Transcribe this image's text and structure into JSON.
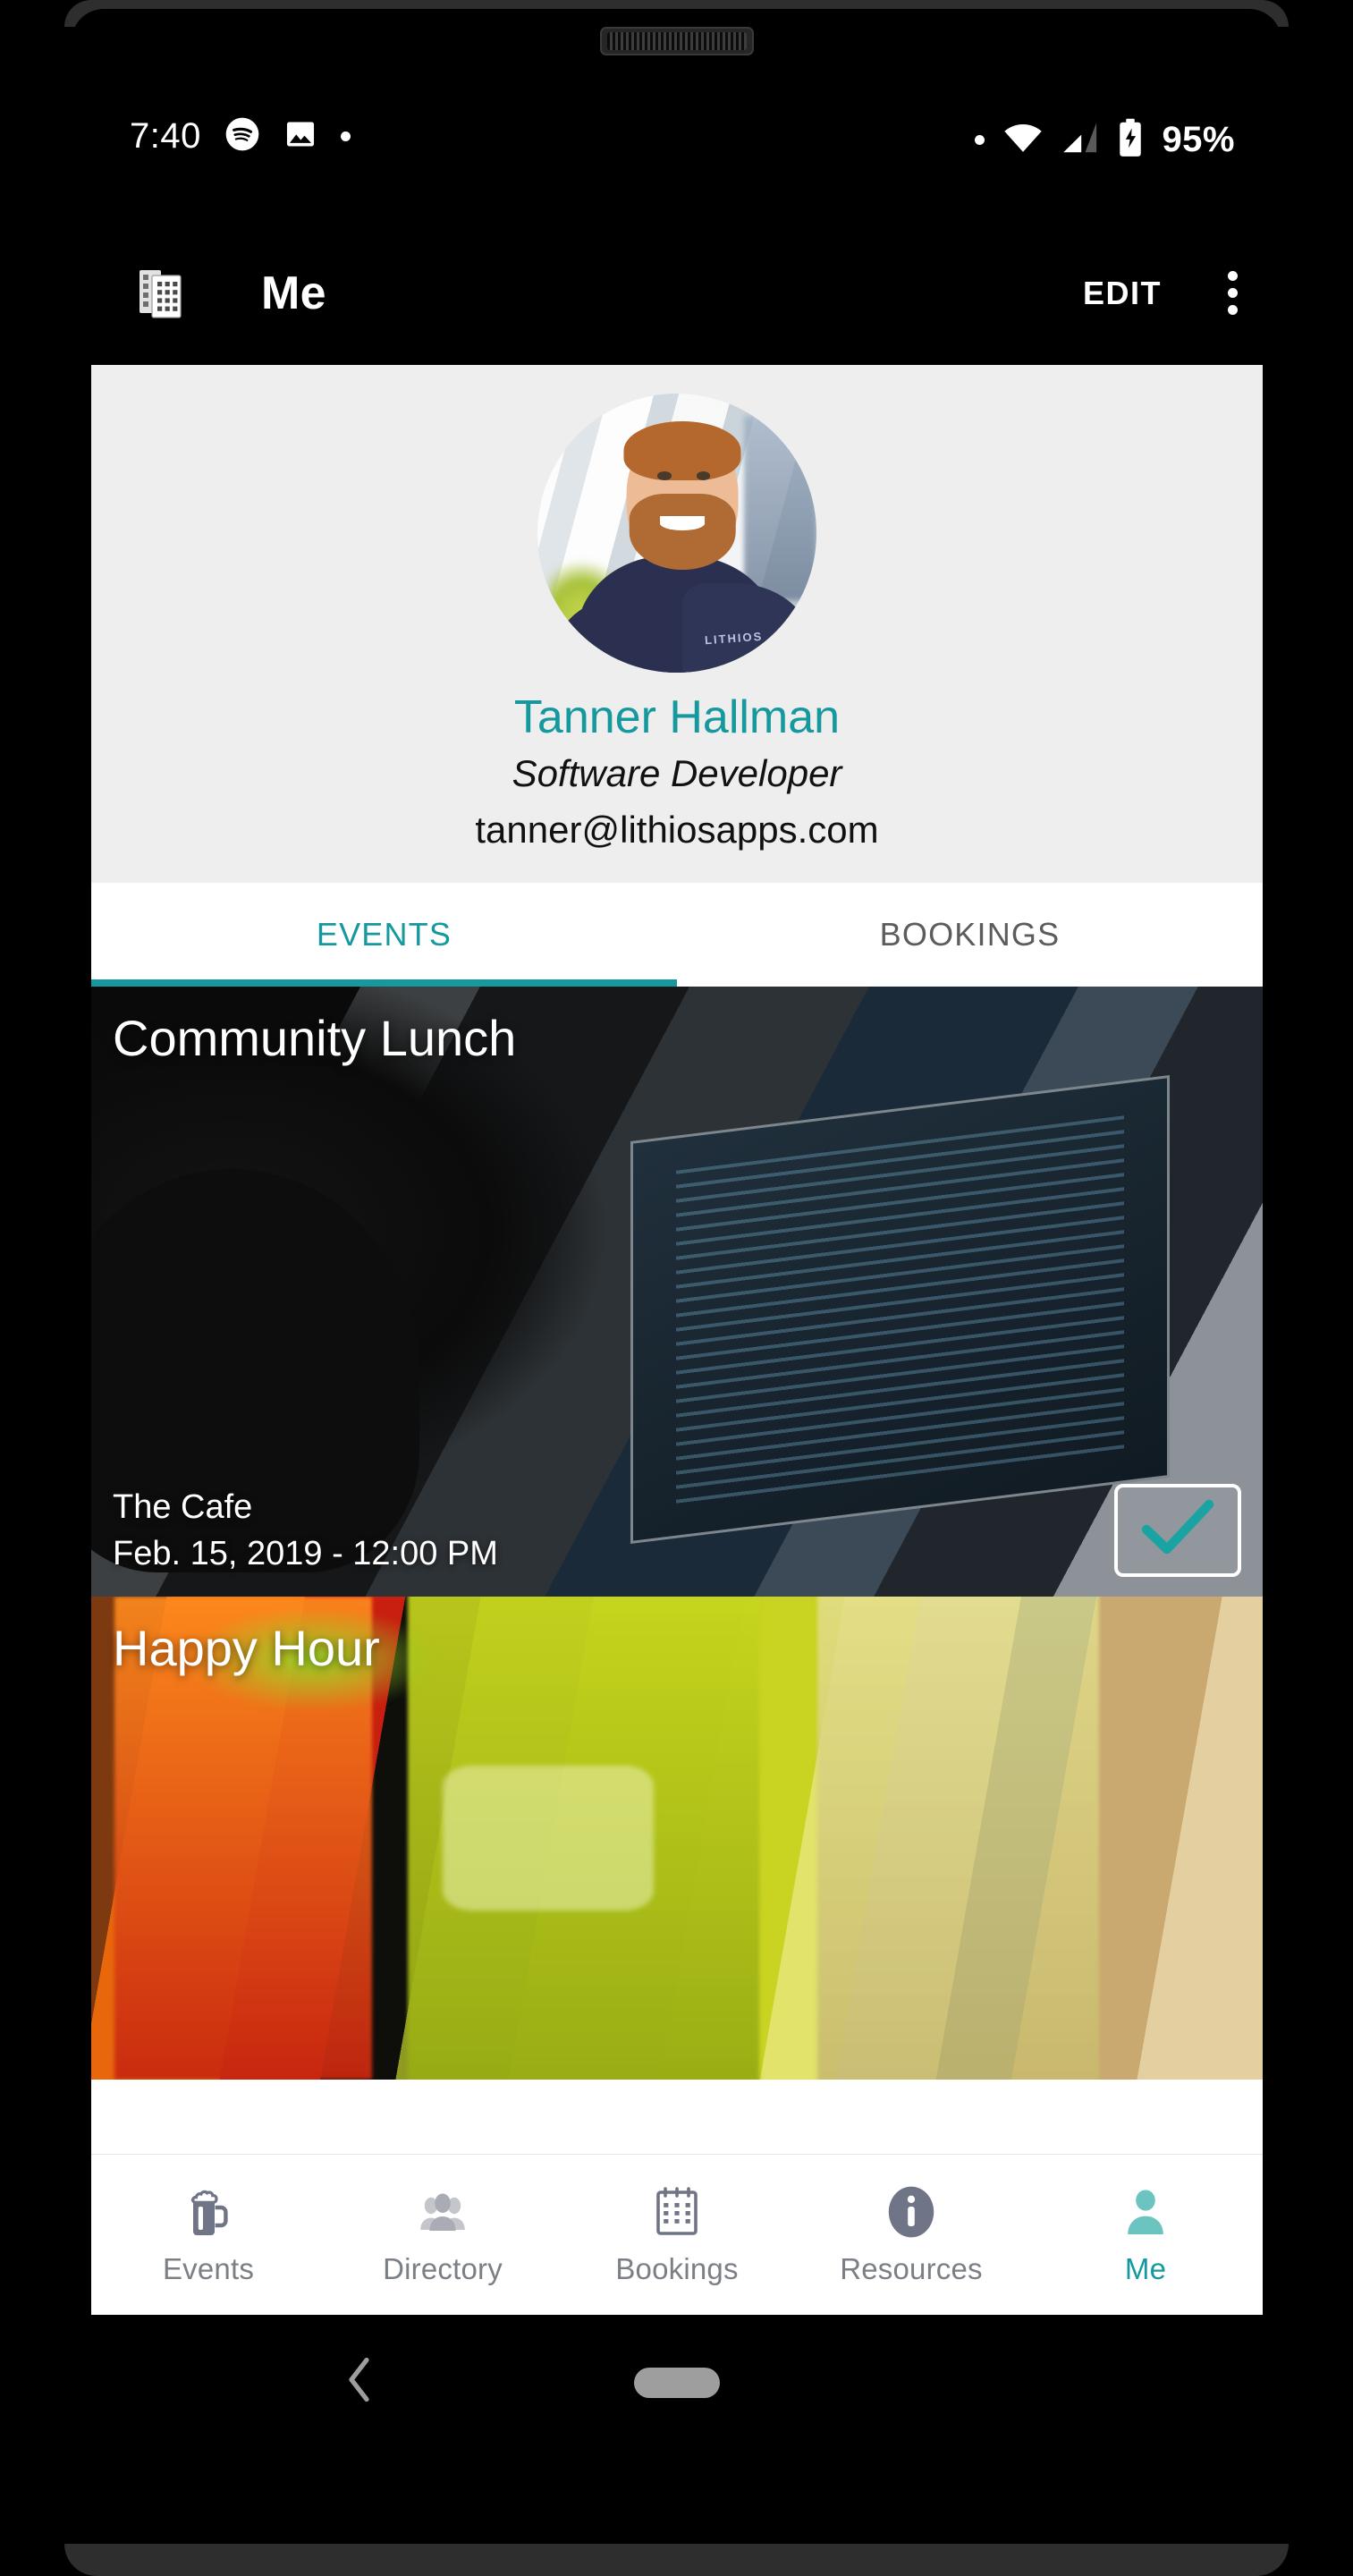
{
  "statusbar": {
    "time": "7:40",
    "icons_left": [
      "spotify-icon",
      "image-icon",
      "dot-indicator"
    ],
    "icons_right": [
      "dot-indicator",
      "wifi-icon",
      "cell-signal-icon",
      "battery-charging-icon"
    ],
    "battery": "95%"
  },
  "appbar": {
    "logo_icon": "office-buildings-icon",
    "title": "Me",
    "edit_label": "EDIT",
    "overflow_icon": "more-vertical-icon"
  },
  "profile": {
    "avatar_alt": "profile-photo",
    "name": "Tanner Hallman",
    "role": "Software Developer",
    "email": "tanner@lithiosapps.com"
  },
  "tabs": [
    {
      "label": "EVENTS",
      "active": true
    },
    {
      "label": "BOOKINGS",
      "active": false
    }
  ],
  "events": [
    {
      "title": "Community Lunch",
      "place": "The Cafe",
      "when": "Feb. 15, 2019 - 12:00 PM",
      "rsvp_icon": "check-icon",
      "rsvp_state": "attending"
    },
    {
      "title": "Happy Hour"
    }
  ],
  "bottomnav": [
    {
      "label": "Events",
      "icon": "beer-mug-icon",
      "active": false
    },
    {
      "label": "Directory",
      "icon": "people-icon",
      "active": false
    },
    {
      "label": "Bookings",
      "icon": "calendar-icon",
      "active": false
    },
    {
      "label": "Resources",
      "icon": "info-circle-icon",
      "active": false
    },
    {
      "label": "Me",
      "icon": "person-icon",
      "active": true
    }
  ],
  "androidnav": {
    "back_icon": "chevron-left-icon",
    "home_icon": "home-pill-icon"
  },
  "colors": {
    "accent_teal": "#16999e",
    "card_bg": "#eeeeee",
    "surface": "#ffffff",
    "inactive_gray": "#7b7f86"
  }
}
